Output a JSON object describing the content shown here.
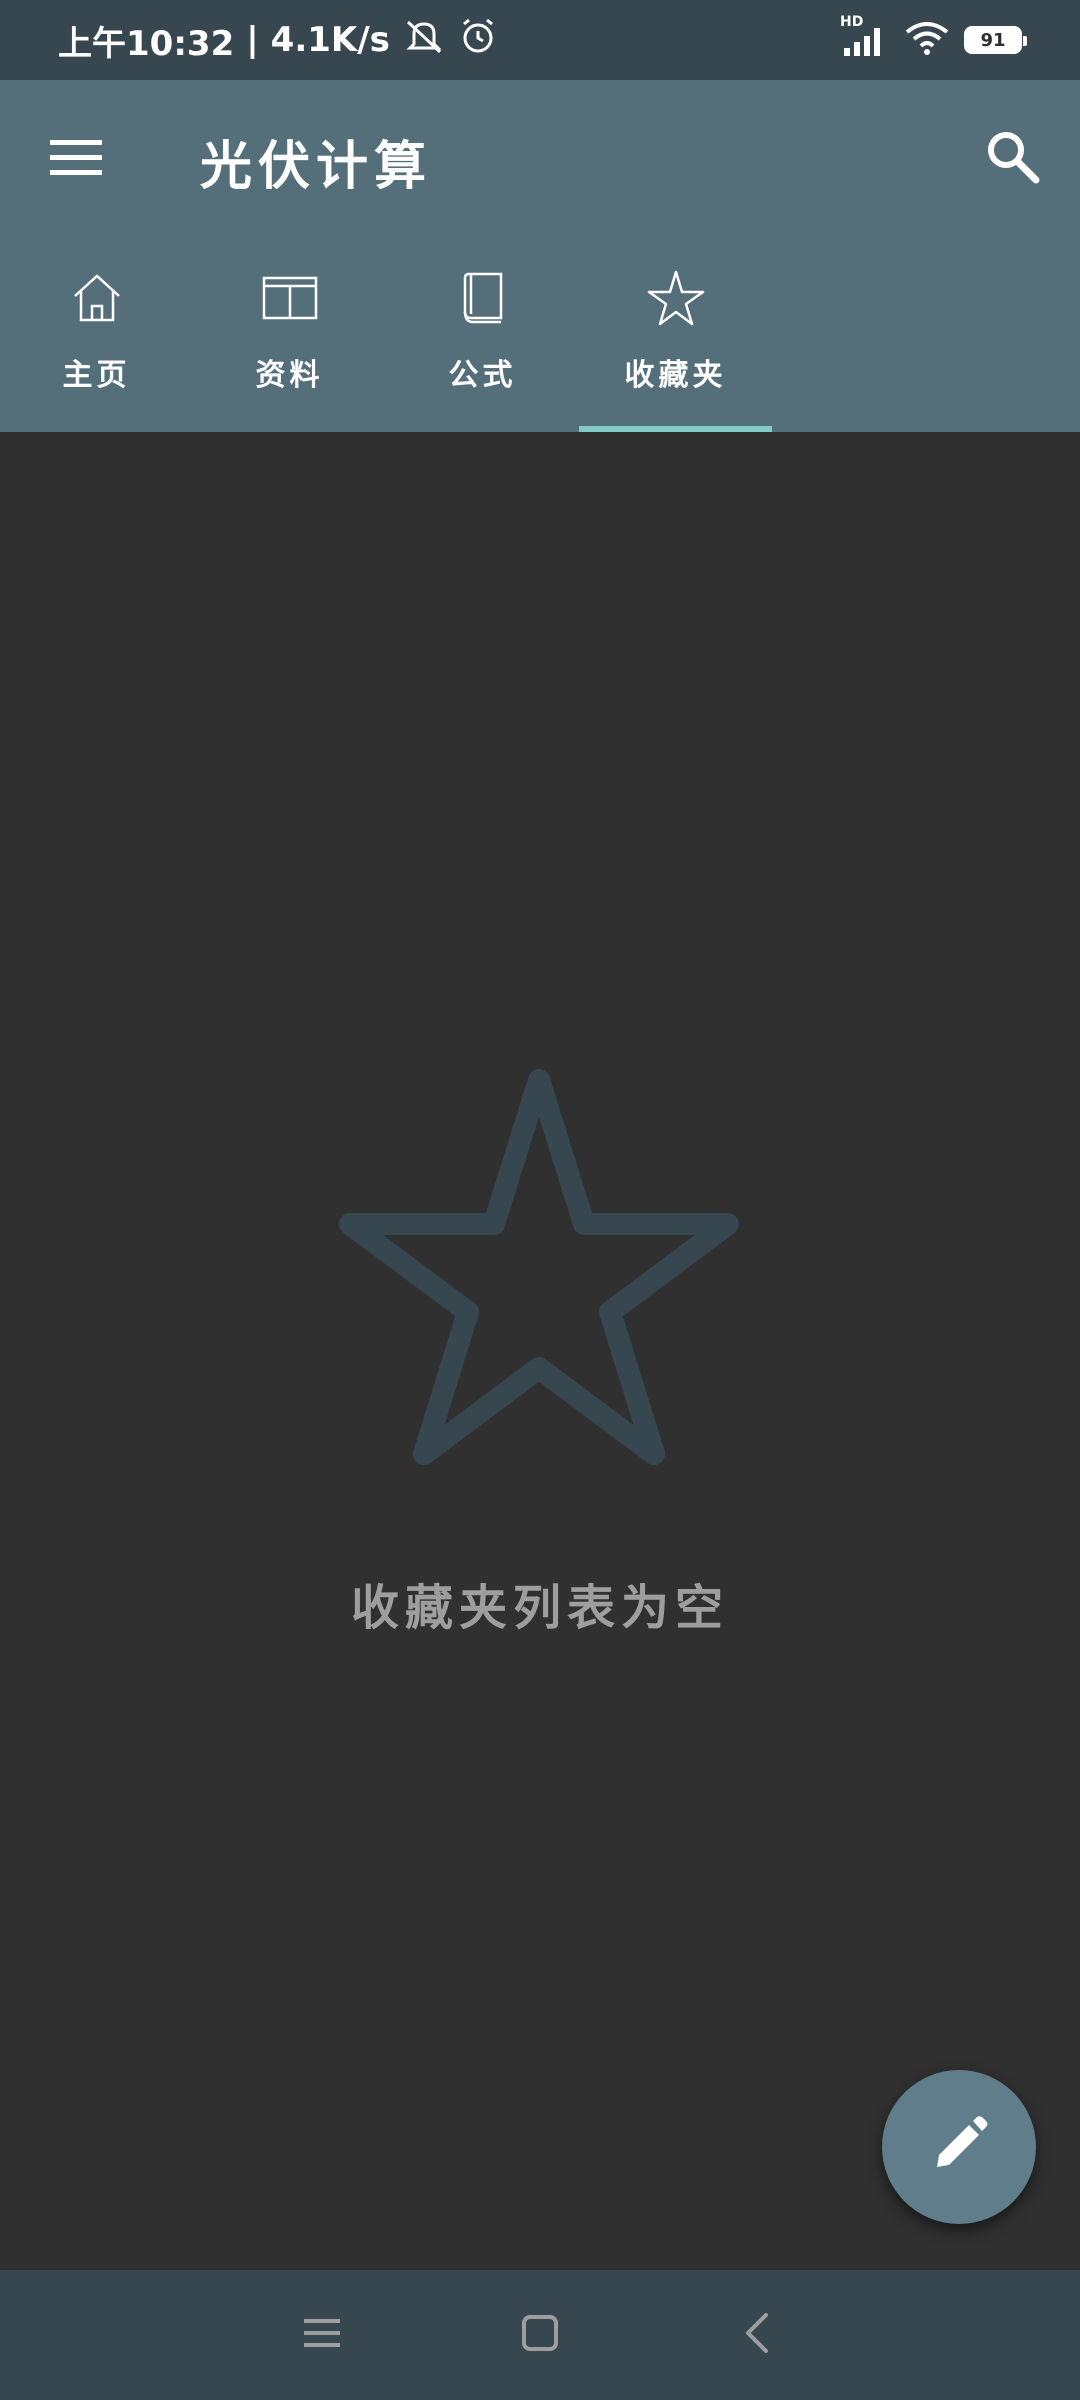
{
  "status_bar": {
    "time": "上午10:32",
    "speed": "4.1K/s",
    "network": "HD",
    "battery": "91",
    "icons": [
      "mute-icon",
      "alarm-icon",
      "signal-icon",
      "wifi-icon",
      "battery-icon"
    ]
  },
  "app_bar": {
    "title": "光伏计算",
    "icons": [
      "menu-icon",
      "search-icon"
    ]
  },
  "tabs": [
    {
      "label": "主页",
      "icon": "home-icon"
    },
    {
      "label": "资料",
      "icon": "table-icon"
    },
    {
      "label": "公式",
      "icon": "book-icon"
    },
    {
      "label": "收藏夹",
      "icon": "star-icon",
      "selected": true
    }
  ],
  "empty_state": {
    "icon": "star-outline-icon",
    "message": "收藏夹列表为空"
  },
  "fab": {
    "icon": "edit-icon"
  },
  "nav_bar": {
    "icons": [
      "recent-apps-icon",
      "home-button-icon",
      "back-icon"
    ]
  },
  "colors": {
    "app_bar": "#546E7A",
    "status_bar": "#37474F",
    "background": "#303030",
    "tab_indicator": "#80CBC4",
    "fab": "#607D8B",
    "empty_icon": "#37474F"
  }
}
